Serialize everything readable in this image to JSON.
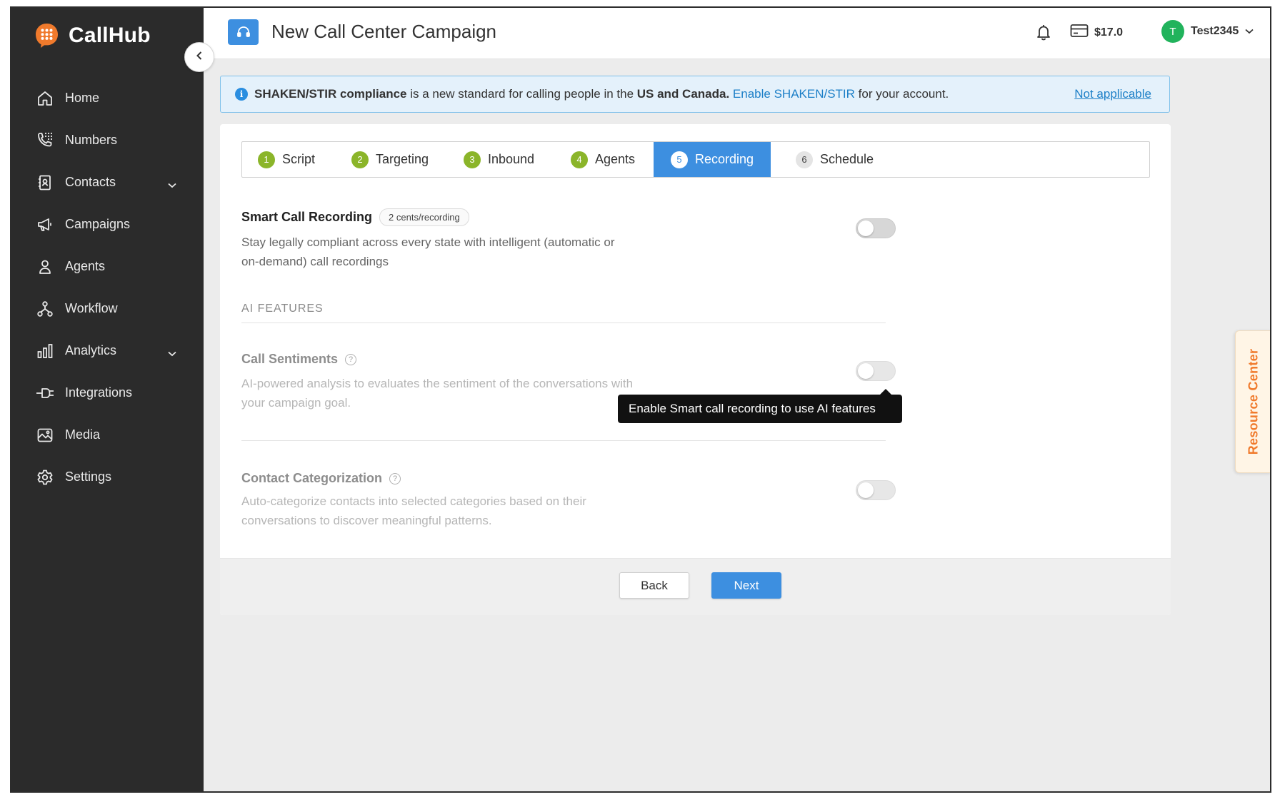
{
  "brand": {
    "name": "CallHub"
  },
  "sidebar": {
    "items": [
      {
        "label": "Home",
        "icon": "home-icon",
        "expandable": false
      },
      {
        "label": "Numbers",
        "icon": "phone-dialpad-icon",
        "expandable": false
      },
      {
        "label": "Contacts",
        "icon": "address-book-icon",
        "expandable": true
      },
      {
        "label": "Campaigns",
        "icon": "megaphone-icon",
        "expandable": false
      },
      {
        "label": "Agents",
        "icon": "person-icon",
        "expandable": false
      },
      {
        "label": "Workflow",
        "icon": "workflow-icon",
        "expandable": false
      },
      {
        "label": "Analytics",
        "icon": "bar-chart-icon",
        "expandable": true
      },
      {
        "label": "Integrations",
        "icon": "plug-icon",
        "expandable": false
      },
      {
        "label": "Media",
        "icon": "image-icon",
        "expandable": false
      },
      {
        "label": "Settings",
        "icon": "gear-icon",
        "expandable": false
      }
    ]
  },
  "header": {
    "title": "New Call Center Campaign",
    "balance": "$17.0",
    "user": {
      "initial": "T",
      "name": "Test2345"
    }
  },
  "banner": {
    "strong1": "SHAKEN/STIR compliance",
    "text1": " is a new standard for calling people in the ",
    "strong2": "US and Canada.",
    "link": "Enable SHAKEN/STIR",
    "text2": " for your account.",
    "dismiss": "Not applicable"
  },
  "steps": [
    {
      "num": "1",
      "label": "Script",
      "state": "done"
    },
    {
      "num": "2",
      "label": "Targeting",
      "state": "done"
    },
    {
      "num": "3",
      "label": "Inbound",
      "state": "done"
    },
    {
      "num": "4",
      "label": "Agents",
      "state": "done"
    },
    {
      "num": "5",
      "label": "Recording",
      "state": "active"
    },
    {
      "num": "6",
      "label": "Schedule",
      "state": "todo"
    }
  ],
  "recording": {
    "title": "Smart Call Recording",
    "badge": "2 cents/recording",
    "desc_line1": "Stay legally compliant across every state with intelligent (automatic or",
    "desc_line2": "on-demand) call recordings",
    "enabled": false
  },
  "ai": {
    "section_label": "AI FEATURES",
    "sentiments": {
      "title": "Call Sentiments",
      "help": "?",
      "desc_line1": "AI-powered analysis to evaluates the sentiment of the conversations with",
      "desc_line2": "your campaign goal.",
      "enabled": false
    },
    "categorization": {
      "title": "Contact Categorization",
      "help": "?",
      "desc_line1": "Auto-categorize contacts into selected categories based on their",
      "desc_line2": "conversations to discover meaningful patterns.",
      "enabled": false
    },
    "tooltip": "Enable Smart call recording to use AI features"
  },
  "footer": {
    "back": "Back",
    "next": "Next"
  },
  "resource_center": {
    "label": "Resource Center"
  },
  "colors": {
    "primary": "#3d8fe0",
    "step_done": "#8bb52a",
    "sidebar_bg": "#2b2b2b",
    "accent_orange": "#f07a2c",
    "avatar": "#21b35c"
  }
}
